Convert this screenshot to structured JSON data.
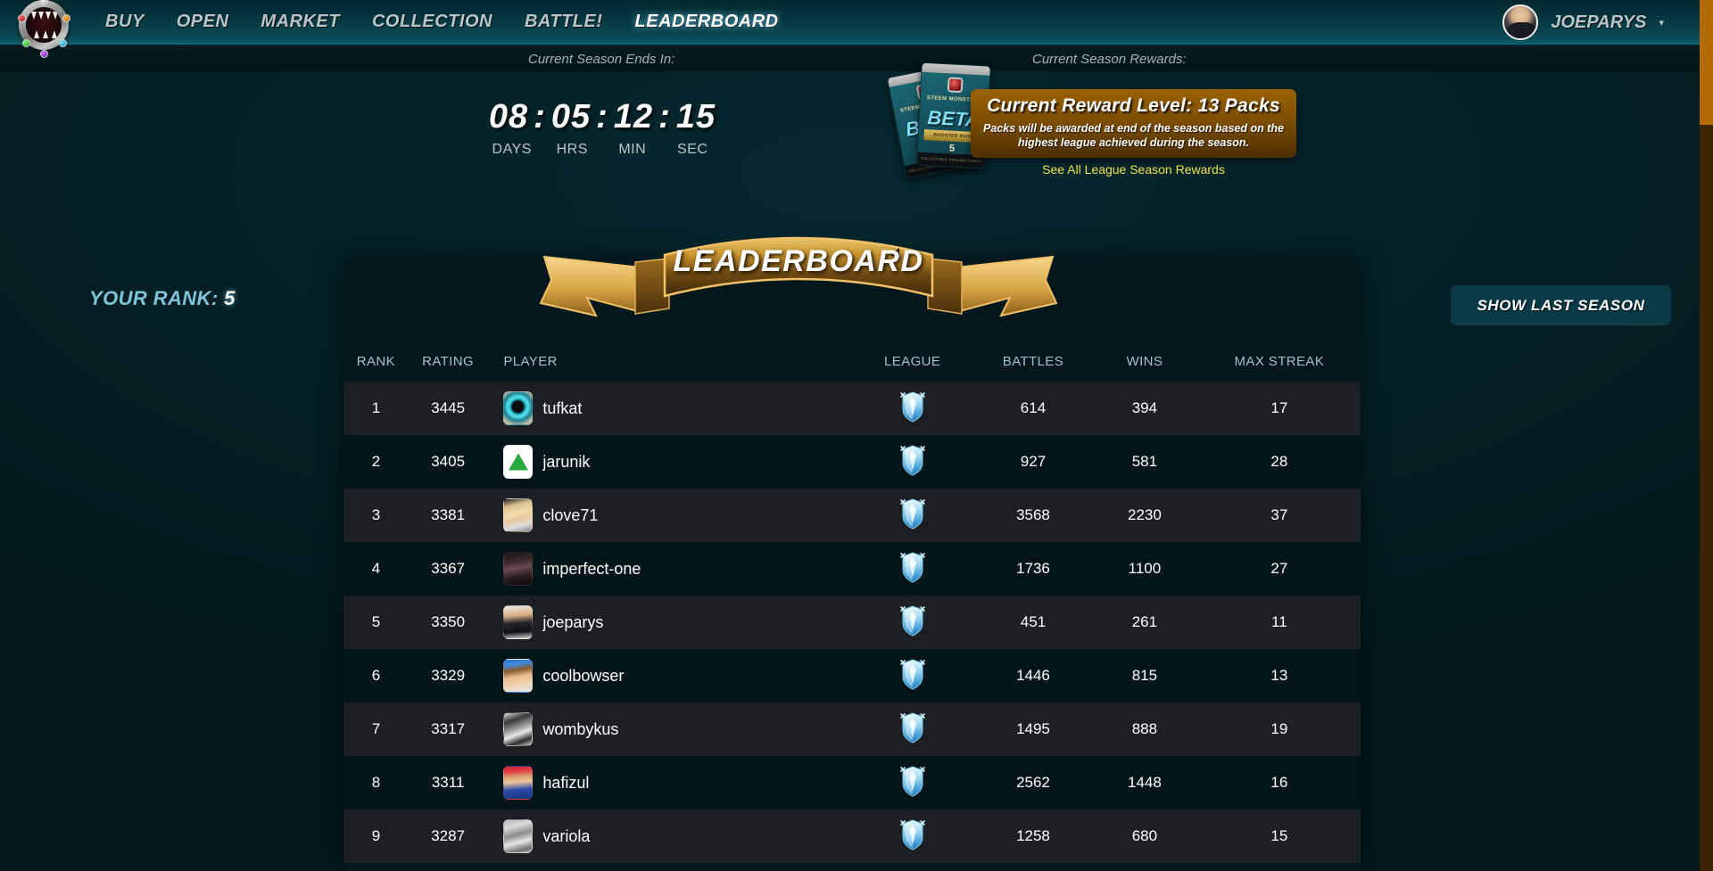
{
  "nav": {
    "logo_icon": "splinterlands-monster-logo",
    "links": [
      {
        "label": "BUY",
        "active": false
      },
      {
        "label": "OPEN",
        "active": false
      },
      {
        "label": "MARKET",
        "active": false
      },
      {
        "label": "COLLECTION",
        "active": false
      },
      {
        "label": "BATTLE!",
        "active": false
      },
      {
        "label": "LEADERBOARD",
        "active": true
      }
    ],
    "user": {
      "name": "JOEPARYS",
      "caret_icon": "chevron-down-icon",
      "avatar_icon": "user-avatar"
    }
  },
  "season": {
    "ends_label": "Current Season Ends In:",
    "rewards_label": "Current Season Rewards:",
    "countdown": {
      "days": "08",
      "hours": "05",
      "minutes": "12",
      "seconds": "15",
      "separator": ":",
      "labels": [
        "DAYS",
        "HRS",
        "MIN",
        "SEC"
      ]
    },
    "reward": {
      "title": "Current Reward Level: 13 Packs",
      "description": "Packs will be awarded at end of the season based on the highest league achieved during the season.",
      "link": "See All League Season Rewards",
      "pack": {
        "brand": "STEEM MONSTERS",
        "set": "BETA",
        "ribbon": "BOOSTER PACK",
        "count": "5",
        "footer": "COLLECTIBLE TRADING CARDS"
      }
    }
  },
  "leaderboard": {
    "banner_title": "LEADERBOARD",
    "your_rank_label": "YOUR RANK:",
    "your_rank_value": "5",
    "last_season_button": "SHOW LAST SEASON",
    "columns": [
      "RANK",
      "RATING",
      "PLAYER",
      "LEAGUE",
      "BATTLES",
      "WINS",
      "MAX STREAK"
    ],
    "rows": [
      {
        "rank": "1",
        "rating": "3445",
        "player": "tufkat",
        "league": "Diamond",
        "battles": "614",
        "wins": "394",
        "max_streak": "17",
        "avatar_class": "av-tufkat"
      },
      {
        "rank": "2",
        "rating": "3405",
        "player": "jarunik",
        "league": "Diamond",
        "battles": "927",
        "wins": "581",
        "max_streak": "28",
        "avatar_class": "av-jarunik"
      },
      {
        "rank": "3",
        "rating": "3381",
        "player": "clove71",
        "league": "Diamond",
        "battles": "3568",
        "wins": "2230",
        "max_streak": "37",
        "avatar_class": "av-clove71"
      },
      {
        "rank": "4",
        "rating": "3367",
        "player": "imperfect-one",
        "league": "Diamond",
        "battles": "1736",
        "wins": "1100",
        "max_streak": "27",
        "avatar_class": "av-imperfect"
      },
      {
        "rank": "5",
        "rating": "3350",
        "player": "joeparys",
        "league": "Diamond",
        "battles": "451",
        "wins": "261",
        "max_streak": "11",
        "avatar_class": "av-joeparys"
      },
      {
        "rank": "6",
        "rating": "3329",
        "player": "coolbowser",
        "league": "Diamond",
        "battles": "1446",
        "wins": "815",
        "max_streak": "13",
        "avatar_class": "av-coolbowser"
      },
      {
        "rank": "7",
        "rating": "3317",
        "player": "wombykus",
        "league": "Diamond",
        "battles": "1495",
        "wins": "888",
        "max_streak": "19",
        "avatar_class": "av-wombykus"
      },
      {
        "rank": "8",
        "rating": "3311",
        "player": "hafizul",
        "league": "Diamond",
        "battles": "2562",
        "wins": "1448",
        "max_streak": "16",
        "avatar_class": "av-hafizul"
      },
      {
        "rank": "9",
        "rating": "3287",
        "player": "variola",
        "league": "Diamond",
        "battles": "1258",
        "wins": "680",
        "max_streak": "15",
        "avatar_class": "av-variola"
      }
    ]
  },
  "colors": {
    "page_background": "#04242b",
    "navbar_accent": "#0d5662",
    "card_background": "#04171c",
    "row_odd": "#1c2024",
    "row_even": "#041519",
    "header_text": "#9fc3cc",
    "accent_gold": "#f2e34a",
    "reward_panel": "#7d4e02",
    "button_background": "#0b3a46",
    "scrollbar": "#b36b00"
  }
}
